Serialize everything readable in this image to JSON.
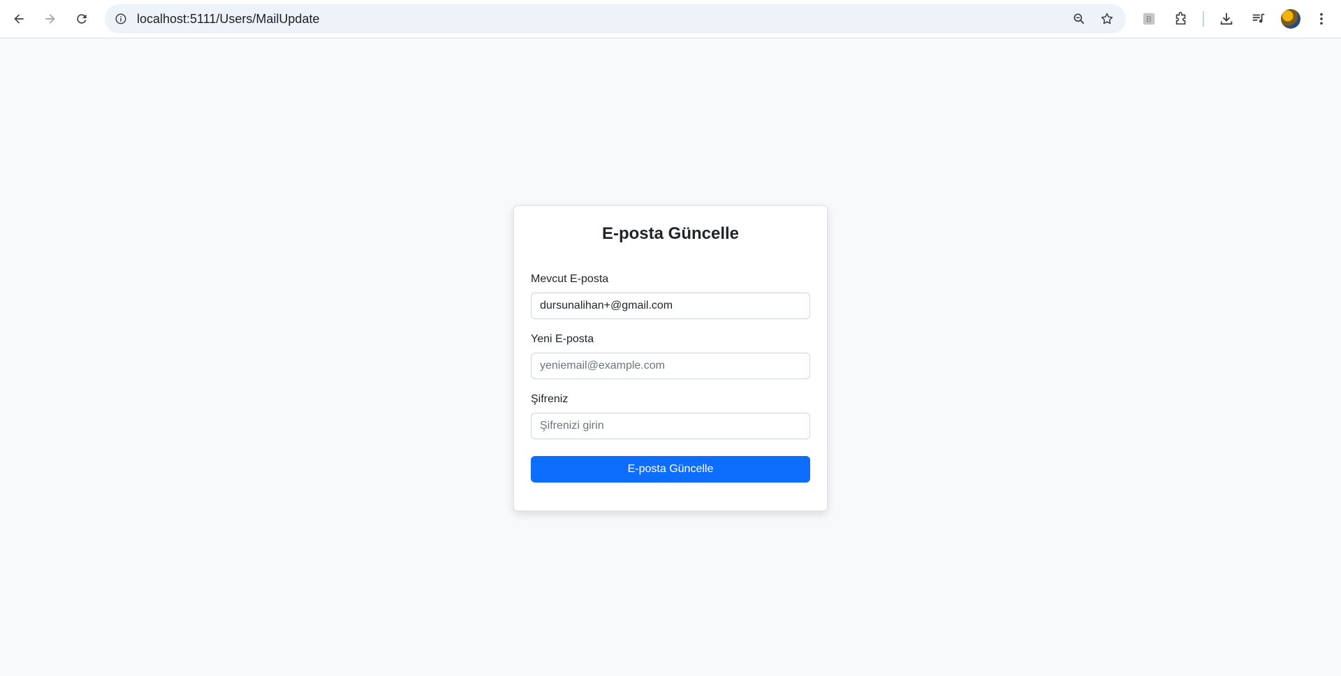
{
  "browser": {
    "url": "localhost:5111/Users/MailUpdate",
    "icons": [
      "back-icon",
      "forward-icon",
      "reload-icon",
      "site-info-icon",
      "zoom-icon",
      "bookmark-star-icon",
      "extension-b-icon",
      "extensions-puzzle-icon",
      "download-icon",
      "media-queue-icon",
      "profile-avatar",
      "menu-dots-icon"
    ]
  },
  "form": {
    "title": "E-posta Güncelle",
    "current_email_label": "Mevcut E-posta",
    "current_email_value": "dursunalihan+@gmail.com",
    "new_email_label": "Yeni E-posta",
    "new_email_placeholder": "yeniemail@example.com",
    "password_label": "Şifreniz",
    "password_placeholder": "Şifrenizi girin",
    "submit_label": "E-posta Güncelle"
  },
  "colors": {
    "page_bg": "#f8f9fa",
    "primary": "#0d6efd",
    "omnibox_bg": "#eef2f9"
  }
}
